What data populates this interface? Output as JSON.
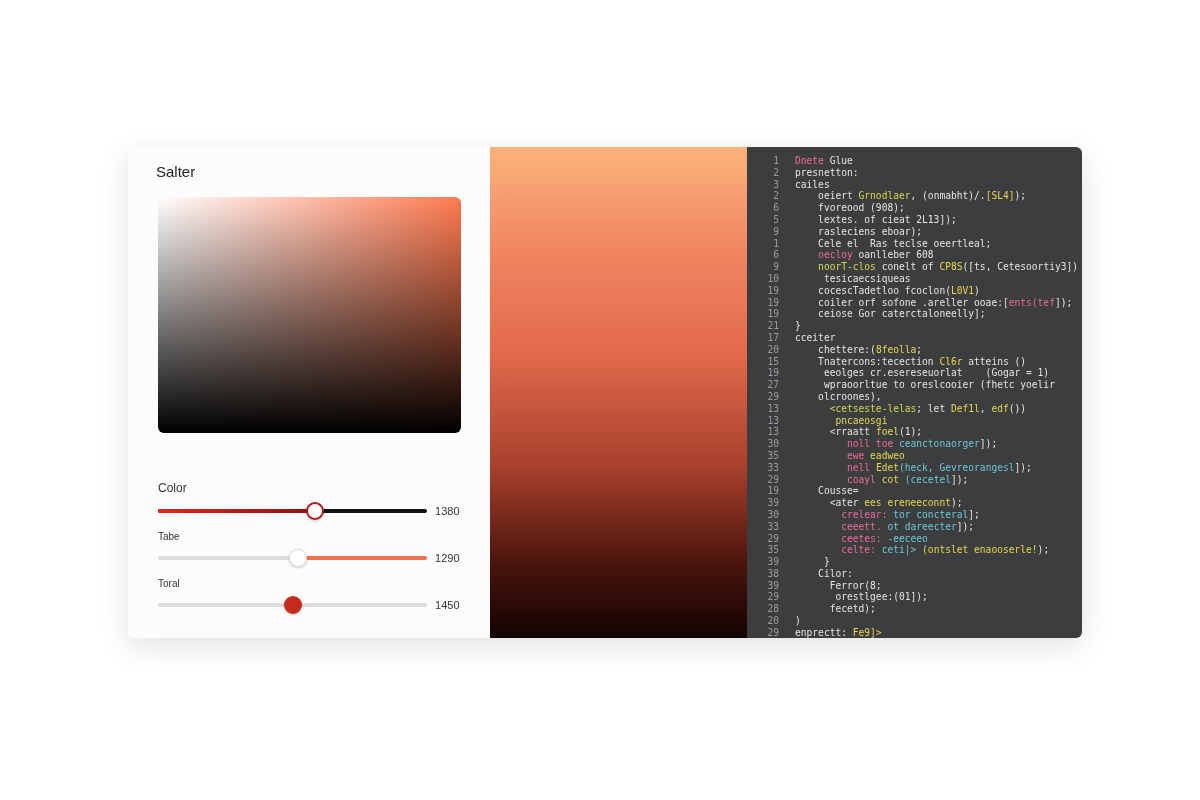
{
  "panel": {
    "title": "Salter"
  },
  "sliders": [
    {
      "label": "Color",
      "kind": "fill_left",
      "level": 0.585,
      "reading": "1380"
    },
    {
      "label": "Tabe",
      "kind": "fill_right",
      "level": 0.52,
      "reading": "1290"
    },
    {
      "label": "Toral",
      "kind": "solid_thumb",
      "level": 0.5,
      "reading": "1450"
    }
  ],
  "code": [
    {
      "n": "1",
      "tokens": [
        {
          "t": "Dnete",
          "kind": "keyword"
        },
        {
          "t": " Glue",
          "kind": "plain"
        }
      ]
    },
    {
      "n": "2",
      "tokens": [
        {
          "t": "presnetton:",
          "kind": "plain"
        }
      ]
    },
    {
      "n": "3",
      "tokens": [
        {
          "t": "cailes",
          "kind": "plain"
        }
      ]
    },
    {
      "n": "2",
      "tokens": [
        {
          "t": "    oeiert ",
          "kind": "plain"
        },
        {
          "t": "Grnodlaer",
          "kind": "function"
        },
        {
          "t": ", (onmabht)/.",
          "kind": "plain"
        },
        {
          "t": "[SL4]",
          "kind": "string"
        },
        {
          "t": ");",
          "kind": "plain"
        }
      ]
    },
    {
      "n": "6",
      "tokens": [
        {
          "t": "    fvoreood (908);",
          "kind": "plain"
        }
      ]
    },
    {
      "n": "5",
      "tokens": [
        {
          "t": "    lextes. of cieat 2L13]);",
          "kind": "plain"
        }
      ]
    },
    {
      "n": "9",
      "tokens": [
        {
          "t": "    rasleciens eboar);",
          "kind": "plain"
        }
      ]
    },
    {
      "n": "1",
      "tokens": [
        {
          "t": "    Cele el  Ras teclse oeertleal;",
          "kind": "plain"
        }
      ]
    },
    {
      "n": "6",
      "tokens": [
        {
          "t": "    oecloy",
          "kind": "keyword"
        },
        {
          "t": " oanlleber 608",
          "kind": "plain"
        }
      ]
    },
    {
      "n": "9",
      "tokens": [
        {
          "t": "    noorT-clos",
          "kind": "function"
        },
        {
          "t": " conelt of ",
          "kind": "plain"
        },
        {
          "t": "CP8S",
          "kind": "string"
        },
        {
          "t": "([ts, Cetesoortiy3])",
          "kind": "plain"
        }
      ]
    },
    {
      "n": "10",
      "tokens": [
        {
          "t": "     tesicaecsiqueas",
          "kind": "plain"
        }
      ]
    },
    {
      "n": "19",
      "tokens": [
        {
          "t": "    cocescTadetloo fcoclon(",
          "kind": "plain"
        },
        {
          "t": "L0V1",
          "kind": "string"
        },
        {
          "t": ")",
          "kind": "plain"
        }
      ]
    },
    {
      "n": "19",
      "tokens": [
        {
          "t": "    coiler orf sofone .areller ooae:[",
          "kind": "plain"
        },
        {
          "t": "ents(tef",
          "kind": "keyword"
        },
        {
          "t": "]);",
          "kind": "plain"
        }
      ]
    },
    {
      "n": "19",
      "tokens": [
        {
          "t": "    ceiose Gor caterctaloneelly];",
          "kind": "plain"
        }
      ]
    },
    {
      "n": "21",
      "tokens": [
        {
          "t": "}",
          "kind": "plain"
        }
      ]
    },
    {
      "n": "17",
      "tokens": [
        {
          "t": "cceiter",
          "kind": "plain"
        }
      ]
    },
    {
      "n": "20",
      "tokens": [
        {
          "t": "    chettere:(",
          "kind": "plain"
        },
        {
          "t": "8feolla",
          "kind": "string"
        },
        {
          "t": ";",
          "kind": "plain"
        }
      ]
    },
    {
      "n": "15",
      "tokens": [
        {
          "t": "    Tnatercons:tecection ",
          "kind": "plain"
        },
        {
          "t": "Cl6r",
          "kind": "string"
        },
        {
          "t": " atteins ()",
          "kind": "plain"
        }
      ]
    },
    {
      "n": "19",
      "tokens": [
        {
          "t": "     eeolges cr.esereseuorlat    (Gogar = 1)",
          "kind": "plain"
        }
      ]
    },
    {
      "n": "27",
      "tokens": [
        {
          "t": "     wpraoorltue to oreslcooier (fhetc yoelir",
          "kind": "plain"
        }
      ]
    },
    {
      "n": "29",
      "tokens": [
        {
          "t": "    olcroones),",
          "kind": "plain"
        }
      ]
    },
    {
      "n": "13",
      "tokens": [
        {
          "t": "      <cetseste-lelas",
          "kind": "function"
        },
        {
          "t": "; let ",
          "kind": "plain"
        },
        {
          "t": "Def1l",
          "kind": "string"
        },
        {
          "t": ", ",
          "kind": "plain"
        },
        {
          "t": "edf",
          "kind": "string"
        },
        {
          "t": "())",
          "kind": "plain"
        }
      ]
    },
    {
      "n": "13",
      "tokens": [
        {
          "t": "       pncaeosgi",
          "kind": "string"
        }
      ]
    },
    {
      "n": "13",
      "tokens": [
        {
          "t": "      <rraatt ",
          "kind": "plain"
        },
        {
          "t": "foel",
          "kind": "string"
        },
        {
          "t": "(1);",
          "kind": "plain"
        }
      ]
    },
    {
      "n": "30",
      "tokens": [
        {
          "t": "         noll toe ",
          "kind": "keyword"
        },
        {
          "t": "ceanctonaorger",
          "kind": "value"
        },
        {
          "t": "]);",
          "kind": "plain"
        }
      ]
    },
    {
      "n": "35",
      "tokens": [
        {
          "t": "         ewe ",
          "kind": "keyword"
        },
        {
          "t": "eadweo",
          "kind": "string"
        }
      ]
    },
    {
      "n": "33",
      "tokens": [
        {
          "t": "         nell ",
          "kind": "keyword"
        },
        {
          "t": "Edet",
          "kind": "string"
        },
        {
          "t": "(heck, ",
          "kind": "value"
        },
        {
          "t": "Gevreorangesl",
          "kind": "value"
        },
        {
          "t": "]);",
          "kind": "plain"
        }
      ]
    },
    {
      "n": "29",
      "tokens": [
        {
          "t": "         coayl ",
          "kind": "keyword"
        },
        {
          "t": "cot ",
          "kind": "string"
        },
        {
          "t": "(cecetel",
          "kind": "value"
        },
        {
          "t": "]);",
          "kind": "plain"
        }
      ]
    },
    {
      "n": "19",
      "tokens": [
        {
          "t": "    Cousse=",
          "kind": "plain"
        }
      ]
    },
    {
      "n": "39",
      "tokens": [
        {
          "t": "      <ater ",
          "kind": "plain"
        },
        {
          "t": "ees ereneeconnt",
          "kind": "string"
        },
        {
          "t": ");",
          "kind": "plain"
        }
      ]
    },
    {
      "n": "30",
      "tokens": [
        {
          "t": "        crelear: ",
          "kind": "keyword"
        },
        {
          "t": "tor concteral",
          "kind": "value"
        },
        {
          "t": "];",
          "kind": "plain"
        }
      ]
    },
    {
      "n": "33",
      "tokens": [
        {
          "t": "        ceeett. ",
          "kind": "keyword"
        },
        {
          "t": "ot dareecter",
          "kind": "value"
        },
        {
          "t": "]);",
          "kind": "plain"
        }
      ]
    },
    {
      "n": "29",
      "tokens": [
        {
          "t": "        ceetes: ",
          "kind": "keyword"
        },
        {
          "t": "-eeceeo",
          "kind": "value"
        }
      ]
    },
    {
      "n": "35",
      "tokens": [
        {
          "t": "        celte: ",
          "kind": "keyword"
        },
        {
          "t": "ceti|> ",
          "kind": "value"
        },
        {
          "t": "(ontslet ",
          "kind": "string"
        },
        {
          "t": "enaooserle!",
          "kind": "string"
        },
        {
          "t": ");",
          "kind": "plain"
        }
      ]
    },
    {
      "n": "39",
      "tokens": [
        {
          "t": "     }",
          "kind": "plain"
        }
      ]
    },
    {
      "n": "38",
      "tokens": [
        {
          "t": "    Cilor:",
          "kind": "plain"
        }
      ]
    },
    {
      "n": "39",
      "tokens": [
        {
          "t": "      Ferror(8;",
          "kind": "plain"
        }
      ]
    },
    {
      "n": "29",
      "tokens": [
        {
          "t": "       orestlgee:(01]);",
          "kind": "plain"
        }
      ]
    },
    {
      "n": "28",
      "tokens": [
        {
          "t": "      fecetd);",
          "kind": "plain"
        }
      ]
    },
    {
      "n": "20",
      "tokens": [
        {
          "t": ")",
          "kind": "plain"
        }
      ]
    },
    {
      "n": "29",
      "tokens": [
        {
          "t": "enprectt: ",
          "kind": "plain"
        },
        {
          "t": "Fe9]>",
          "kind": "string"
        }
      ]
    }
  ]
}
